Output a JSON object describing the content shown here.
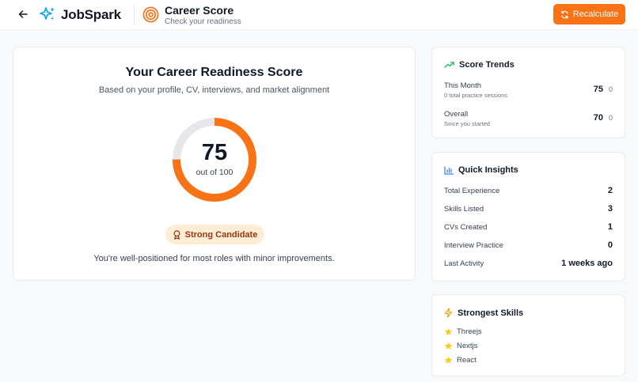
{
  "header": {
    "brand": "JobSpark",
    "title": "Career Score",
    "subtitle": "Check your readiness",
    "recalculate_label": "Recalculate"
  },
  "score": {
    "heading": "Your Career Readiness Score",
    "subheading": "Based on your profile, CV, interviews, and market alignment",
    "value": "75",
    "out_of": "out of 100",
    "progress": 75,
    "badge": "Strong Candidate",
    "message": "You're well-positioned for most roles with minor improvements."
  },
  "trends": {
    "title": "Score Trends",
    "rows": [
      {
        "label": "This Month",
        "note": "0 total practice sessions",
        "value": "75",
        "delta": "0"
      },
      {
        "label": "Overall",
        "note": "Since you started",
        "value": "70",
        "delta": "0"
      }
    ]
  },
  "insights": {
    "title": "Quick Insights",
    "rows": [
      {
        "label": "Total Experience",
        "value": "2"
      },
      {
        "label": "Skills Listed",
        "value": "3"
      },
      {
        "label": "CVs Created",
        "value": "1"
      },
      {
        "label": "Interview Practice",
        "value": "0"
      },
      {
        "label": "Last Activity",
        "value": "1 weeks ago"
      }
    ]
  },
  "skills": {
    "title": "Strongest Skills",
    "items": [
      "Threejs",
      "Nextjs",
      "React"
    ]
  },
  "colors": {
    "accent": "#f97316",
    "brand_icon": "#0ea5e9",
    "ring_track": "#e5e7eb",
    "badge_bg": "#ffedd5",
    "trend_icon": "#22c55e",
    "insight_icon": "#3b82f6",
    "star": "#facc15"
  }
}
